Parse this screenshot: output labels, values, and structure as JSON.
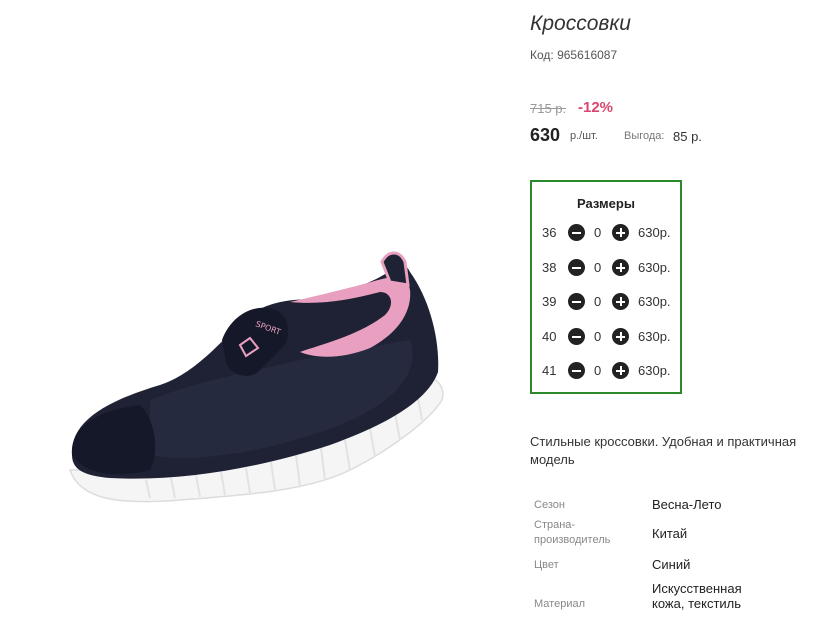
{
  "product": {
    "title": "Кроссовки",
    "code": "Код: 965616087",
    "old_price": "715 р.",
    "discount": "-12%",
    "price": "630",
    "price_unit": "р./шт.",
    "saving_label": "Выгода:",
    "saving_value": "85 р.",
    "description": "Стильные кроссовки. Удобная и практичная модель"
  },
  "sizes": {
    "title": "Размеры",
    "rows": [
      {
        "size": "36",
        "qty": "0",
        "price": "630р."
      },
      {
        "size": "38",
        "qty": "0",
        "price": "630р."
      },
      {
        "size": "39",
        "qty": "0",
        "price": "630р."
      },
      {
        "size": "40",
        "qty": "0",
        "price": "630р."
      },
      {
        "size": "41",
        "qty": "0",
        "price": "630р."
      }
    ]
  },
  "properties": [
    {
      "name": "Сезон",
      "value": "Весна-Лето"
    },
    {
      "name": "Страна-производитель",
      "value": "Китай"
    },
    {
      "name": "Цвет",
      "value": "Синий"
    },
    {
      "name": "Материал",
      "value": "Искусственная кожа, текстиль"
    }
  ],
  "image": {
    "badge_text": "SPORT"
  },
  "colors": {
    "accent_green": "#2a8a2a",
    "discount_pink": "#d9466f",
    "shoe_navy": "#1f2235",
    "shoe_pink": "#e9a0c0"
  }
}
